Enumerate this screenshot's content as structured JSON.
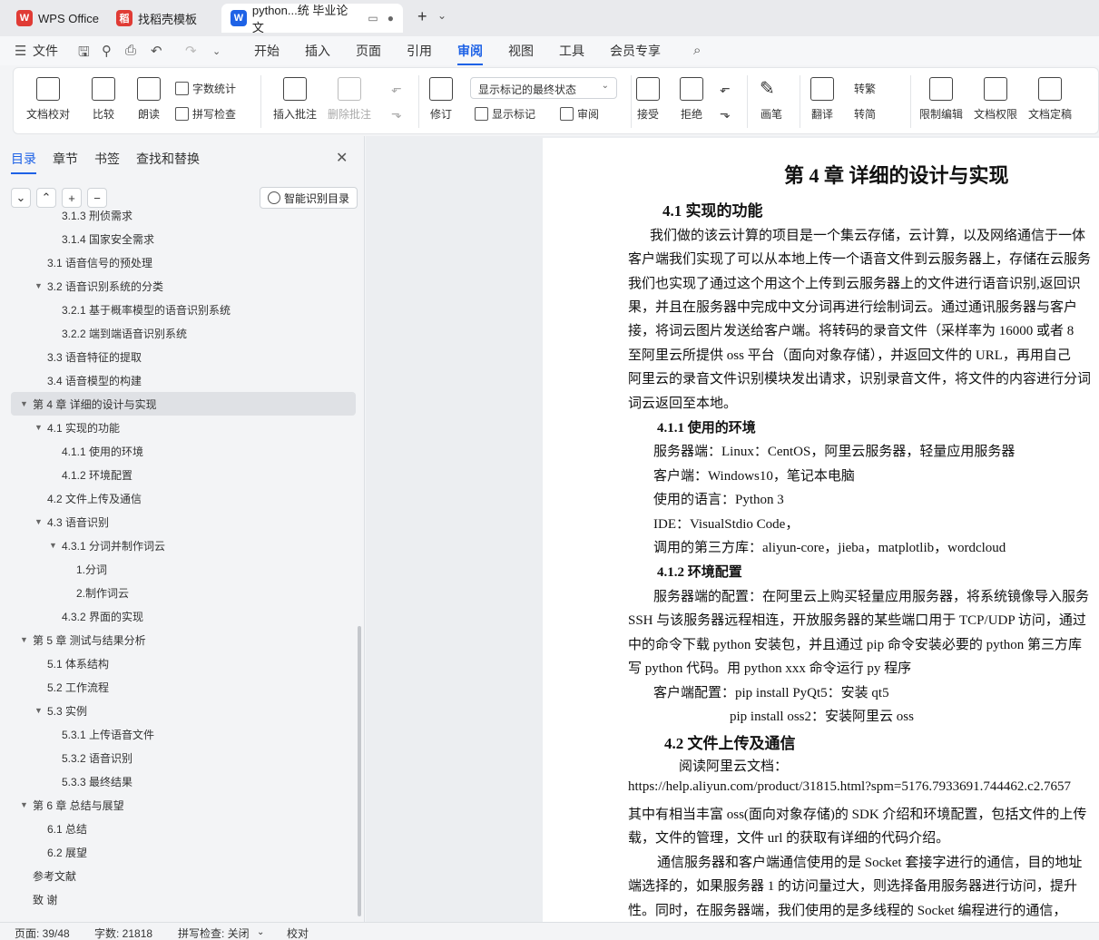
{
  "tabs": [
    {
      "label": "WPS Office",
      "logo": "W",
      "color": "#e03b35"
    },
    {
      "label": "找稻壳模板",
      "logo": "稻",
      "color": "#e03b35"
    },
    {
      "label": "python...统 毕业论文",
      "logo": "W",
      "color": "#1e62e6"
    }
  ],
  "tab_controls": {
    "new": "+",
    "more": "⌄"
  },
  "menu": {
    "file": "文件",
    "items": [
      "开始",
      "插入",
      "页面",
      "引用",
      "审阅",
      "视图",
      "工具",
      "会员专享"
    ],
    "active": "审阅"
  },
  "ribbon": {
    "doc_check": "文档校对",
    "compare": "比较",
    "read_aloud": "朗读",
    "word_count": "字数统计",
    "spell_check": "拼写检查",
    "insert_comment": "插入批注",
    "delete_comment": "删除批注",
    "track": "修订",
    "markup_dropdown": "显示标记的最终状态",
    "show_markup": "显示标记",
    "review": "审阅",
    "accept": "接受",
    "reject": "拒绝",
    "pen": "画笔",
    "translate": "翻译",
    "to_traditional": "转繁",
    "to_simplified": "转简",
    "restrict_edit": "限制编辑",
    "doc_permission": "文档权限",
    "doc_finalize": "文档定稿"
  },
  "nav": {
    "tabs": [
      "目录",
      "章节",
      "书签",
      "查找和替换"
    ],
    "active_tab": "目录",
    "smart_toc": "智能识别目录",
    "toc": [
      {
        "label": "3.1.3 刑侦需求",
        "level": 3,
        "caret": ""
      },
      {
        "label": "3.1.4 国家安全需求",
        "level": 3,
        "caret": ""
      },
      {
        "label": "3.1  语音信号的预处理",
        "level": 2,
        "caret": ""
      },
      {
        "label": "3.2  语音识别系统的分类",
        "level": 2,
        "caret": "▼"
      },
      {
        "label": "3.2.1  基于概率模型的语音识别系统",
        "level": 3,
        "caret": ""
      },
      {
        "label": "3.2.2  端到端语音识别系统",
        "level": 3,
        "caret": ""
      },
      {
        "label": "3.3  语音特征的提取",
        "level": 2,
        "caret": ""
      },
      {
        "label": "3.4  语音模型的构建",
        "level": 2,
        "caret": ""
      },
      {
        "label": "第 4 章  详细的设计与实现",
        "level": 1,
        "caret": "▼",
        "selected": true
      },
      {
        "label": "4.1 实现的功能",
        "level": 2,
        "caret": "▼"
      },
      {
        "label": "4.1.1 使用的环境",
        "level": 3,
        "caret": ""
      },
      {
        "label": "4.1.2 环境配置",
        "level": 3,
        "caret": ""
      },
      {
        "label": "4.2 文件上传及通信",
        "level": 2,
        "caret": ""
      },
      {
        "label": "4.3 语音识别",
        "level": 2,
        "caret": "▼"
      },
      {
        "label": "4.3.1 分词并制作词云",
        "level": 3,
        "caret": "▼"
      },
      {
        "label": "1.分词",
        "level": 4,
        "caret": ""
      },
      {
        "label": "2.制作词云",
        "level": 4,
        "caret": ""
      },
      {
        "label": "4.3.2 界面的实现",
        "level": 3,
        "caret": ""
      },
      {
        "label": "第 5 章  测试与结果分析",
        "level": 1,
        "caret": "▼"
      },
      {
        "label": "5.1 体系结构",
        "level": 2,
        "caret": ""
      },
      {
        "label": "5.2 工作流程",
        "level": 2,
        "caret": ""
      },
      {
        "label": "5.3 实例",
        "level": 2,
        "caret": "▼"
      },
      {
        "label": "5.3.1 上传语音文件",
        "level": 3,
        "caret": ""
      },
      {
        "label": "5.3.2 语音识别",
        "level": 3,
        "caret": ""
      },
      {
        "label": "5.3.3 最终结果",
        "level": 3,
        "caret": ""
      },
      {
        "label": "第 6 章  总结与展望",
        "level": 1,
        "caret": "▼"
      },
      {
        "label": "6.1 总结",
        "level": 2,
        "caret": ""
      },
      {
        "label": "6.2 展望",
        "level": 2,
        "caret": ""
      },
      {
        "label": "参考文献",
        "level": 1,
        "caret": ""
      },
      {
        "label": "致   谢",
        "level": 1,
        "caret": ""
      }
    ]
  },
  "document": {
    "lines": [
      {
        "text": "第 4 章  详细的设计与实现",
        "style": "h1"
      },
      {
        "text": "4.1 实现的功能",
        "style": "h2"
      },
      {
        "text": "我们做的该云计算的项目是一个集云存储，云计算，以及网络通信于一体",
        "style": "p"
      },
      {
        "text": "客户端我们实现了可以从本地上传一个语音文件到云服务器上，存储在云服务",
        "style": "p"
      },
      {
        "text": "我们也实现了通过这个用这个上传到云服务器上的文件进行语音识别,返回识",
        "style": "p"
      },
      {
        "text": "果，并且在服务器中完成中文分词再进行绘制词云。通过通讯服务器与客户",
        "style": "p"
      },
      {
        "text": "接，将词云图片发送给客户端。将转码的录音文件（采样率为 16000 或者 8",
        "style": "p"
      },
      {
        "text": "至阿里云所提供 oss 平台（面向对象存储），并返回文件的 URL，再用自己",
        "style": "p"
      },
      {
        "text": "阿里云的录音文件识别模块发出请求，识别录音文件，将文件的内容进行分词",
        "style": "p"
      },
      {
        "text": "词云返回至本地。",
        "style": "p"
      },
      {
        "text": "4.1.1 使用的环境",
        "style": "h3"
      },
      {
        "text": "服务器端：Linux：CentOS，阿里云服务器，轻量应用服务器",
        "style": "p"
      },
      {
        "text": "客户端：Windows10，笔记本电脑",
        "style": "p"
      },
      {
        "text": "使用的语言：Python 3",
        "style": "p"
      },
      {
        "text": "IDE：VisualStdio Code，",
        "style": "p"
      },
      {
        "text": "调用的第三方库：aliyun-core，jieba，matplotlib，wordcloud",
        "style": "p"
      },
      {
        "text": "4.1.2 环境配置",
        "style": "h3"
      },
      {
        "text": "服务器端的配置：在阿里云上购买轻量应用服务器，将系统镜像导入服务",
        "style": "p"
      },
      {
        "text": "SSH 与该服务器远程相连，开放服务器的某些端口用于 TCP/UDP 访问，通过",
        "style": "p"
      },
      {
        "text": "中的命令下载 python 安装包，并且通过 pip 命令安装必要的 python 第三方库",
        "style": "p"
      },
      {
        "text": "写 python 代码。用 python xxx 命令运行 py 程序",
        "style": "p"
      },
      {
        "text": "客户端配置：pip install PyQt5：安装 qt5",
        "style": "p"
      },
      {
        "text": "pip install oss2：安装阿里云 oss",
        "style": "p"
      },
      {
        "text": "4.2 文件上传及通信",
        "style": "h2"
      },
      {
        "text": "阅读阿里云文档：",
        "style": "p"
      },
      {
        "text": "https://help.aliyun.com/product/31815.html?spm=5176.7933691.744462.c2.7657",
        "style": "p"
      },
      {
        "text": "其中有相当丰富 oss(面向对象存储)的 SDK 介绍和环境配置，包括文件的上传",
        "style": "p"
      },
      {
        "text": "载，文件的管理，文件 url 的获取有详细的代码介绍。",
        "style": "p"
      },
      {
        "text": "通信服务器和客户端通信使用的是 Socket 套接字进行的通信，目的地址",
        "style": "p"
      },
      {
        "text": "端选择的，如果服务器 1 的访问量过大，则选择备用服务器进行访问，提升",
        "style": "p"
      },
      {
        "text": "性。同时，在服务器端，我们使用的是多线程的 Socket 编程进行的通信，",
        "style": "p"
      }
    ]
  },
  "status": {
    "page": "页面: 39/48",
    "words": "字数: 21818",
    "spell": "拼写检查: 关闭",
    "proof": "校对"
  }
}
